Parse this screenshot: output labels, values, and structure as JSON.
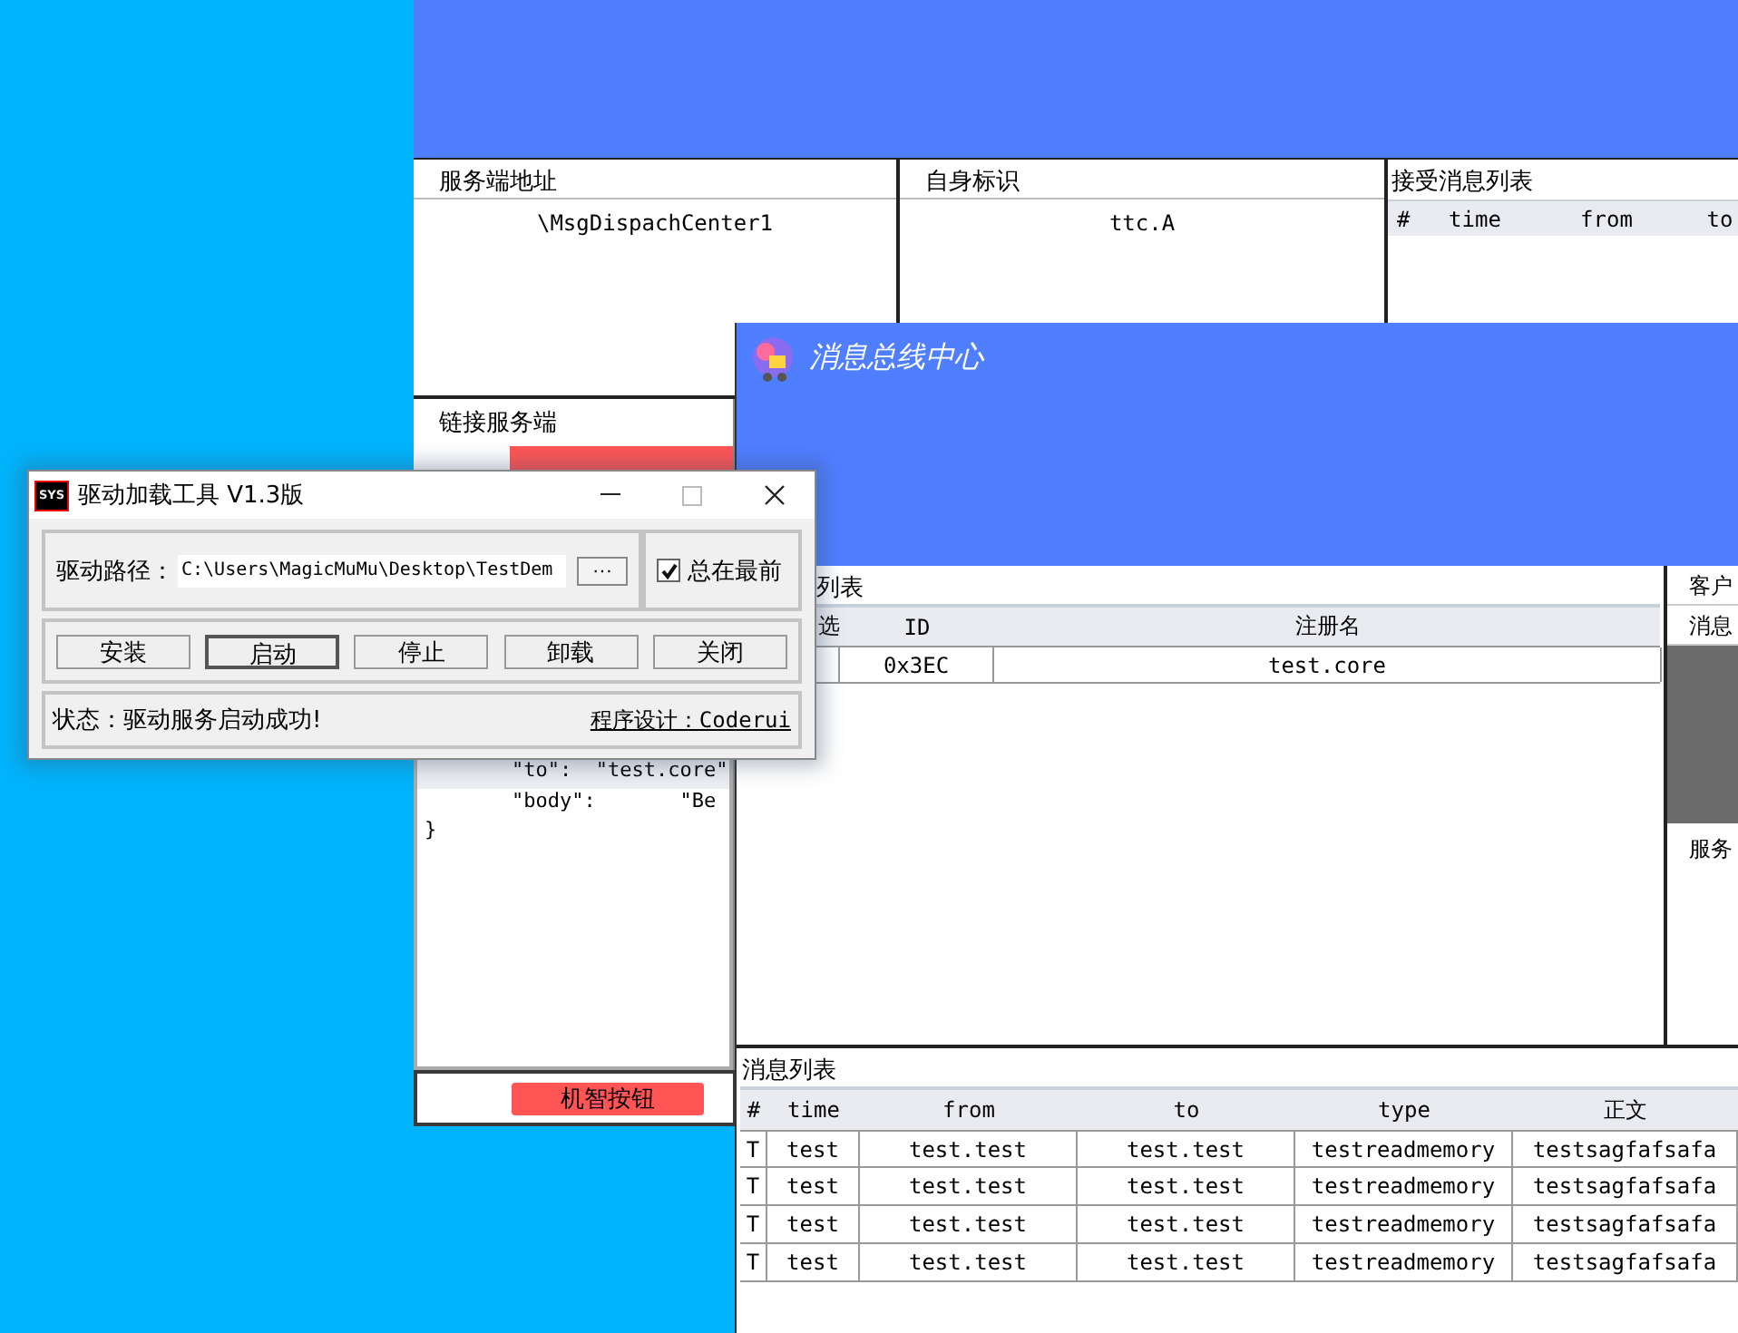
{
  "back_window": {
    "panels": [
      {
        "title": "服务端地址",
        "value": "\\MsgDispachCenter1"
      },
      {
        "title": "自身标识",
        "value": "ttc.A"
      }
    ],
    "received_list": {
      "title": "接受消息列表",
      "columns": [
        "#",
        "time",
        "from",
        "to"
      ]
    },
    "connect_title": "链接服务端",
    "json_lines": [
      {
        "text": "\"to\":  \"test.core\"",
        "highlighted": true
      },
      {
        "text": "\"body\":       \"Be",
        "highlighted": false
      },
      {
        "text": "}",
        "highlighted": false
      }
    ],
    "smart_button": "机智按钮"
  },
  "main_window": {
    "title": "消息总线中心",
    "registry": {
      "title": "列表",
      "columns": [
        "选",
        "ID",
        "注册名"
      ],
      "rows": [
        {
          "id": "0x3EC",
          "name": "test.core"
        }
      ]
    },
    "side_labels": [
      "客户",
      "消息",
      "服务"
    ],
    "messages": {
      "title": "消息列表",
      "columns": [
        "#",
        "time",
        "from",
        "to",
        "type",
        "正文"
      ],
      "rows": [
        {
          "cells": [
            "T",
            "test",
            "test.test",
            "test.test",
            "testreadmemory",
            "testsagfafsafa"
          ]
        },
        {
          "cells": [
            "T",
            "test",
            "test.test",
            "test.test",
            "testreadmemory",
            "testsagfafsafa"
          ]
        },
        {
          "cells": [
            "T",
            "test",
            "test.test",
            "test.test",
            "testreadmemory",
            "testsagfafsafa"
          ]
        },
        {
          "cells": [
            "T",
            "test",
            "test.test",
            "test.test",
            "testreadmemory",
            "testsagfafsafa"
          ]
        }
      ]
    }
  },
  "driver_window": {
    "logo": "SYS",
    "title": "驱动加载工具 V1.3版",
    "path_label": "驱动路径：",
    "path_value": "C:\\Users\\MagicMuMu\\Desktop\\TestDem",
    "browse": "···",
    "always_on_top": {
      "label": "总在最前",
      "checked": true
    },
    "buttons": [
      {
        "label": "安装",
        "focused": false
      },
      {
        "label": "启动",
        "focused": true
      },
      {
        "label": "停止",
        "focused": false
      },
      {
        "label": "卸载",
        "focused": false
      },
      {
        "label": "关闭",
        "focused": false
      }
    ],
    "status": "状态：驱动服务启动成功!",
    "credit": "程序设计：Coderui"
  }
}
